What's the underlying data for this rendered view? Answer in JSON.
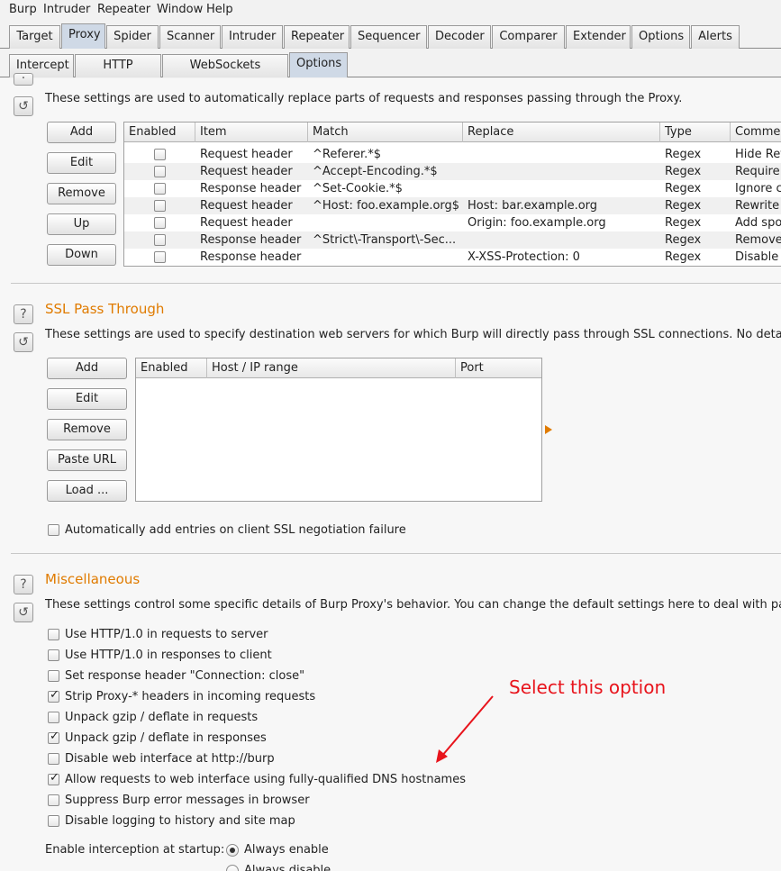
{
  "menu": [
    "Burp",
    "Intruder",
    "Repeater",
    "Window",
    "Help"
  ],
  "tabs": [
    "Target",
    "Proxy",
    "Spider",
    "Scanner",
    "Intruder",
    "Repeater",
    "Sequencer",
    "Decoder",
    "Comparer",
    "Extender",
    "Options",
    "Alerts"
  ],
  "subtabs": [
    "Intercept",
    "HTTP history",
    "WebSockets history",
    "Options"
  ],
  "match_replace": {
    "description": "These settings are used to automatically replace parts of requests and responses passing through the Proxy.",
    "buttons": [
      "Add",
      "Edit",
      "Remove",
      "Up",
      "Down"
    ],
    "columns": [
      "Enabled",
      "Item",
      "Match",
      "Replace",
      "Type",
      "Comment"
    ],
    "rows": [
      {
        "item": "Request header",
        "match": "^Referer.*$",
        "replace": "",
        "type": "Regex",
        "comment": "Hide Ref"
      },
      {
        "item": "Request header",
        "match": "^Accept-Encoding.*$",
        "replace": "",
        "type": "Regex",
        "comment": "Require"
      },
      {
        "item": "Response header",
        "match": "^Set-Cookie.*$",
        "replace": "",
        "type": "Regex",
        "comment": "Ignore c"
      },
      {
        "item": "Request header",
        "match": "^Host: foo.example.org$",
        "replace": "Host: bar.example.org",
        "type": "Regex",
        "comment": "Rewrite"
      },
      {
        "item": "Request header",
        "match": "",
        "replace": "Origin: foo.example.org",
        "type": "Regex",
        "comment": "Add spo"
      },
      {
        "item": "Response header",
        "match": "^Strict\\-Transport\\-Sec...",
        "replace": "",
        "type": "Regex",
        "comment": "Remove"
      },
      {
        "item": "Response header",
        "match": "",
        "replace": "X-XSS-Protection: 0",
        "type": "Regex",
        "comment": "Disable"
      }
    ]
  },
  "ssl_pass_through": {
    "title": "SSL Pass Through",
    "description": "These settings are used to specify destination web servers for which Burp will directly pass through SSL connections. No details a",
    "buttons": [
      "Add",
      "Edit",
      "Remove",
      "Paste URL",
      "Load ..."
    ],
    "columns": [
      "Enabled",
      "Host / IP range",
      "Port"
    ],
    "auto_add_label": "Automatically add entries on client SSL negotiation failure"
  },
  "misc": {
    "title": "Miscellaneous",
    "description": "These settings control some specific details of Burp Proxy's behavior. You can change the default settings here to deal with parti",
    "options": [
      {
        "label": "Use HTTP/1.0 in requests to server",
        "checked": false
      },
      {
        "label": "Use HTTP/1.0 in responses to client",
        "checked": false
      },
      {
        "label": "Set response header \"Connection: close\"",
        "checked": false
      },
      {
        "label": "Strip Proxy-* headers in incoming requests",
        "checked": true
      },
      {
        "label": "Unpack gzip / deflate in requests",
        "checked": false
      },
      {
        "label": "Unpack gzip / deflate in responses",
        "checked": true
      },
      {
        "label": "Disable web interface at http://burp",
        "checked": false
      },
      {
        "label": "Allow requests to web interface using fully-qualified DNS hostnames",
        "checked": true
      },
      {
        "label": "Suppress Burp error messages in browser",
        "checked": false
      },
      {
        "label": "Disable logging to history and site map",
        "checked": false
      }
    ],
    "interception_label": "Enable interception at startup:",
    "interception_options": [
      "Always enable",
      "Always disable"
    ]
  },
  "annotation": {
    "text": "Select this option",
    "color": "#e8141c"
  },
  "colors": {
    "accent": "#e07b00",
    "active_tab": "#cfd9e6"
  }
}
